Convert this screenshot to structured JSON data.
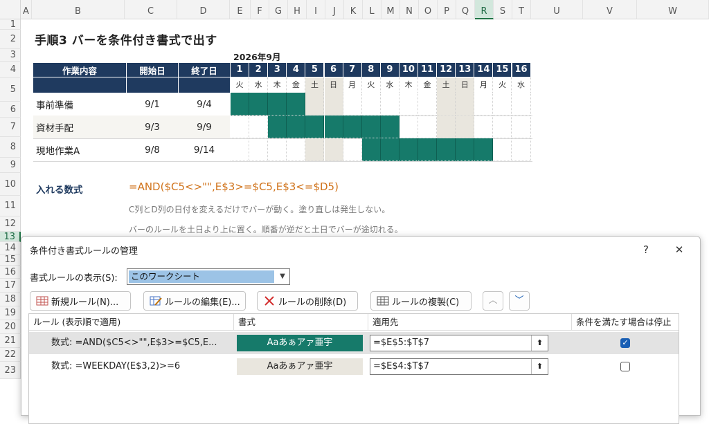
{
  "columns": [
    "A",
    "B",
    "C",
    "D",
    "E",
    "F",
    "G",
    "H",
    "I",
    "J",
    "K",
    "L",
    "M",
    "N",
    "O",
    "P",
    "Q",
    "R",
    "S",
    "T",
    "U",
    "V",
    "W"
  ],
  "selected_column": "R",
  "rows": [
    "1",
    "2",
    "3",
    "4",
    "5",
    "6",
    "7",
    "8",
    "9",
    "10",
    "11",
    "12",
    "13",
    "14",
    "15",
    "16",
    "17",
    "18",
    "19",
    "20",
    "21",
    "22",
    "23"
  ],
  "selected_row": "13",
  "sheet": {
    "title": "手順3 バーを条件付き書式で出す",
    "month_label": "2026年9月",
    "headers": {
      "task": "作業内容",
      "start": "開始日",
      "end": "終了日"
    },
    "days": [
      "1",
      "2",
      "3",
      "4",
      "5",
      "6",
      "7",
      "8",
      "9",
      "10",
      "11",
      "12",
      "13",
      "14",
      "15",
      "16"
    ],
    "weekdays": [
      "火",
      "水",
      "木",
      "金",
      "土",
      "日",
      "月",
      "火",
      "水",
      "木",
      "金",
      "土",
      "日",
      "月",
      "火",
      "水"
    ],
    "weekend_days": [
      5,
      6,
      12,
      13
    ],
    "tasks": [
      {
        "name": "事前準備",
        "start": "9/1",
        "end": "9/4",
        "from": 1,
        "to": 4
      },
      {
        "name": "資材手配",
        "start": "9/3",
        "end": "9/9",
        "from": 3,
        "to": 9
      },
      {
        "name": "現地作業A",
        "start": "9/8",
        "end": "9/14",
        "from": 8,
        "to": 14
      }
    ],
    "formula_label": "入れる数式",
    "formula": "=AND($C5<>\"\",E$3>=$C5,E$3<=$D5)",
    "note1": "C列とD列の日付を変えるだけでバーが動く。塗り直しは発生しない。",
    "note2": "バーのルールを土日より上に置く。順番が逆だと土日でバーが途切れる。"
  },
  "dialog": {
    "title": "条件付き書式ルールの管理",
    "help": "?",
    "close": "✕",
    "show_rules_label": "書式ルールの表示(S):",
    "show_rules_value": "このワークシート",
    "buttons": {
      "new": "新規ルール(N)...",
      "edit": "ルールの編集(E)...",
      "delete": "ルールの削除(D)",
      "duplicate": "ルールの複製(C)"
    },
    "list_headers": {
      "rule": "ルール (表示順で適用)",
      "format": "書式",
      "applies": "適用先",
      "stop": "条件を満たす場合は停止"
    },
    "rules": [
      {
        "rule": "数式: =AND($C5<>\"\",E$3>=$C5,E...",
        "preview": "Aaあぁアァ亜宇",
        "applies": "=$E$5:$T$7",
        "stop": true,
        "fill": "#167a6a",
        "text_color": "#ffffff"
      },
      {
        "rule": "数式: =WEEKDAY(E$3,2)>=6",
        "preview": "Aaあぁアァ亜宇",
        "applies": "=$E$4:$T$7",
        "stop": false,
        "fill": "#e9e6de",
        "text_color": "#222222"
      }
    ]
  }
}
